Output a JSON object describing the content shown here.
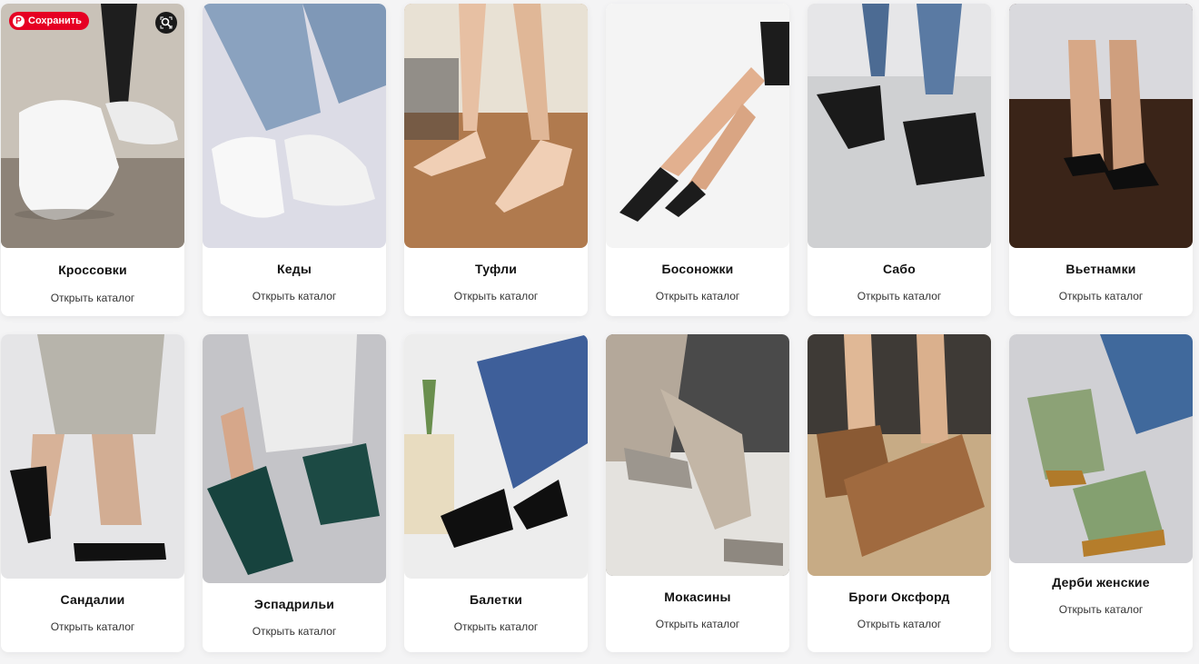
{
  "pin_overlay": {
    "save_label": "Сохранить",
    "pin_icon": "pinterest-logo-icon",
    "lens_icon": "visual-search-icon"
  },
  "cards": [
    {
      "title": "Кроссовки",
      "link": "Открыть каталог",
      "image": "white-sneakers-photo"
    },
    {
      "title": "Кеды",
      "link": "Открыть каталог",
      "image": "white-canvas-sneakers-photo"
    },
    {
      "title": "Туфли",
      "link": "Открыть каталог",
      "image": "nude-studded-heels-photo"
    },
    {
      "title": "Босоножки",
      "link": "Открыть каталог",
      "image": "black-strappy-sandals-photo"
    },
    {
      "title": "Сабо",
      "link": "Открыть каталог",
      "image": "black-mules-photo"
    },
    {
      "title": "Вьетнамки",
      "link": "Открыть каталог",
      "image": "black-flip-flops-photo"
    },
    {
      "title": "Сандалии",
      "link": "Открыть каталог",
      "image": "black-platform-sandals-photo"
    },
    {
      "title": "Эспадрильи",
      "link": "Открыть каталог",
      "image": "green-espadrilles-photo"
    },
    {
      "title": "Балетки",
      "link": "Открыть каталог",
      "image": "black-ballet-flats-photo"
    },
    {
      "title": "Мокасины",
      "link": "Открыть каталог",
      "image": "grey-loafers-photo"
    },
    {
      "title": "Броги Оксфорд",
      "link": "Открыть каталог",
      "image": "brown-brogues-photo"
    },
    {
      "title": "Дерби женские",
      "link": "Открыть каталог",
      "image": "green-suede-derby-photo"
    }
  ]
}
